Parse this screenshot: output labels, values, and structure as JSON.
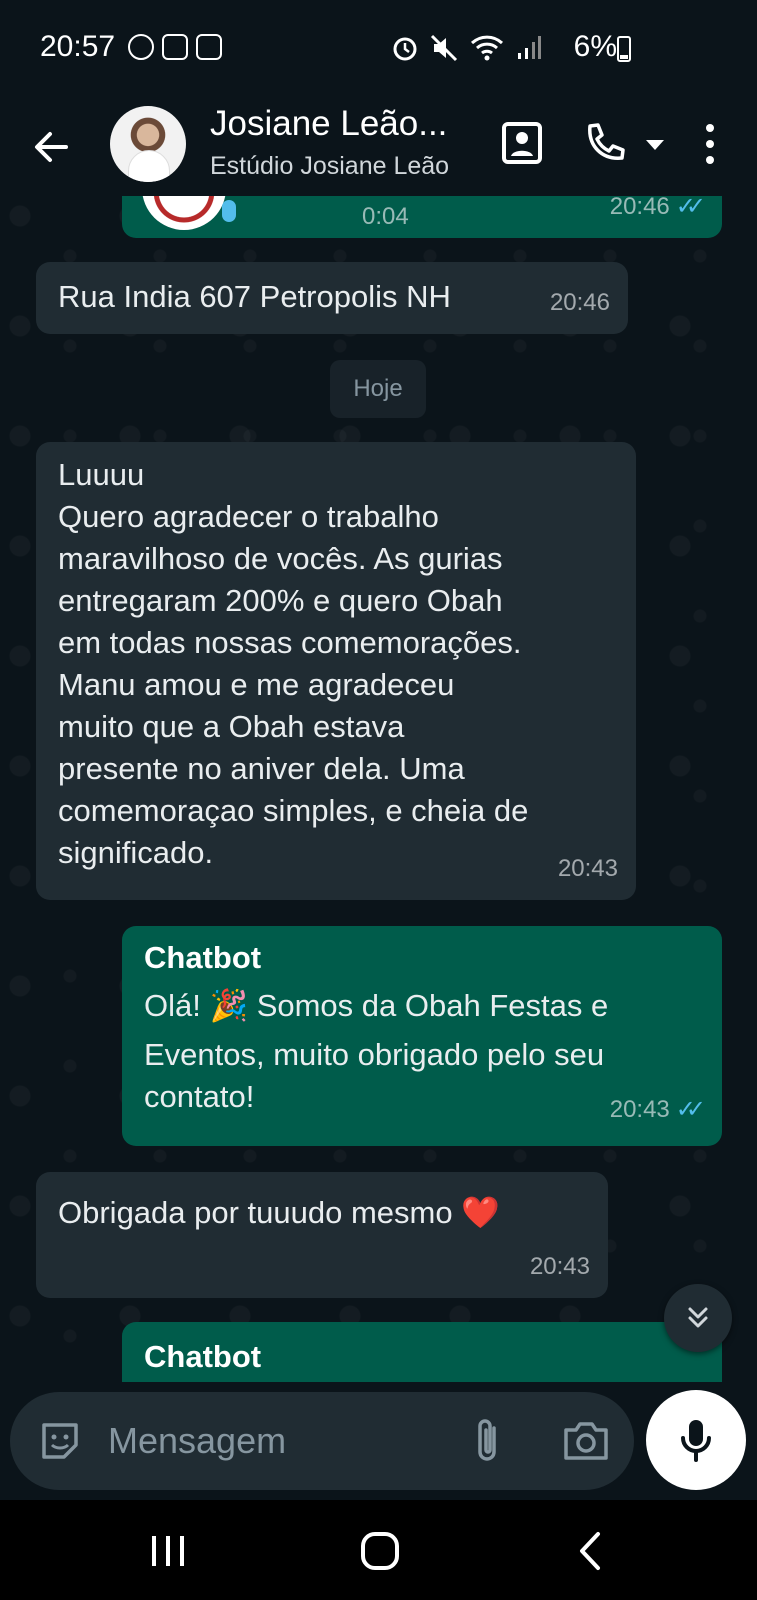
{
  "status_bar": {
    "time": "20:57",
    "battery": "6%",
    "left_icons": [
      "app-badge-icon",
      "voicemail-icon",
      "instagram-icon"
    ],
    "right_icons": [
      "alarm-icon",
      "mute-icon",
      "wifi-icon",
      "signal-icon",
      "battery-charging-icon"
    ]
  },
  "header": {
    "contact_name": "Josiane Leão...",
    "contact_subtitle": "Estúdio Josiane Leão",
    "icons": [
      "back-arrow-icon",
      "contact-card-icon",
      "phone-icon",
      "dropdown-arrow-icon",
      "more-vert-icon"
    ]
  },
  "messages": {
    "audio": {
      "duration": "0:04",
      "time": "20:46"
    },
    "address": {
      "text": "Rua India 607 Petropolis NH",
      "time": "20:46"
    },
    "date_separator": "Hoje",
    "long_message": {
      "lines": [
        "Luuuu",
        "Quero agradecer o trabalho",
        "maravilhoso de vocês. As gurias",
        "entregaram 200% e quero Obah",
        "em todas nossas comemorações.",
        "Manu amou e me agradeceu",
        "muito que a Obah estava",
        "presente no aniver dela. Uma",
        "comemoraçao simples, e cheia de",
        "significado."
      ],
      "time": "20:43"
    },
    "chatbot_reply": {
      "sender": "Chatbot",
      "line1_a": "Olá! ",
      "emoji": "🎉",
      "line1_b": " Somos da Obah Festas e",
      "line2": "Eventos, muito obrigado pelo seu",
      "line3": "contato!",
      "time": "20:43"
    },
    "thanks": {
      "text": "Obrigada por tuuudo mesmo ",
      "emoji": "❤️",
      "time": "20:43"
    },
    "chatbot_partial": {
      "sender": "Chatbot"
    }
  },
  "composer": {
    "placeholder": "Mensagem"
  },
  "colors": {
    "background": "#0b141a",
    "incoming_bubble": "#202c33",
    "outgoing_bubble": "#005c4b",
    "read_ticks": "#53bdeb"
  }
}
